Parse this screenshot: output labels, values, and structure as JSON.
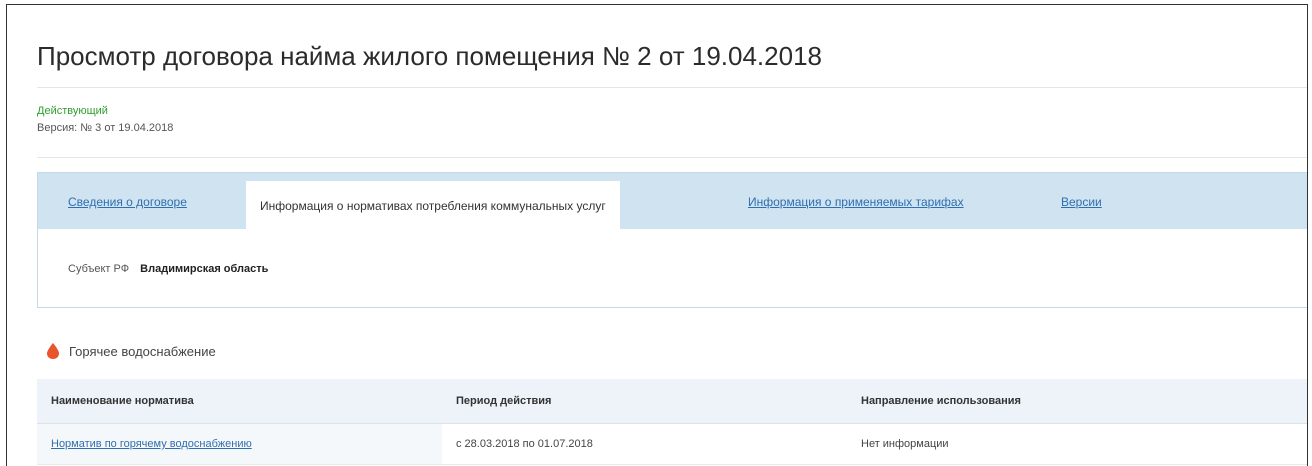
{
  "page": {
    "title": "Просмотр договора найма жилого помещения № 2 от 19.04.2018",
    "status": "Действующий",
    "version": "Версия: № 3 от 19.04.2018"
  },
  "tabs": [
    {
      "label": "Сведения о договоре",
      "active": false
    },
    {
      "label": "Информация о нормативах потребления коммунальных услуг",
      "active": true
    },
    {
      "label": "Информация о применяемых тарифах",
      "active": false
    },
    {
      "label": "Версии",
      "active": false
    }
  ],
  "subject": {
    "label": "Субъект РФ",
    "value": "Владимирская область"
  },
  "section": {
    "title": "Горячее водоснабжение",
    "icon": "water-drop-icon",
    "icon_color": "#e8552b"
  },
  "table": {
    "headers": [
      "Наименование норматива",
      "Период действия",
      "Направление использования"
    ],
    "rows": [
      [
        "Норматив по горячему водоснабжению",
        "с 28.03.2018 по 01.07.2018",
        "Нет информации"
      ]
    ]
  },
  "colors": {
    "status": "#2e9e2e",
    "link": "#2f6fb0",
    "tab_bar": "#d0e3f1"
  }
}
